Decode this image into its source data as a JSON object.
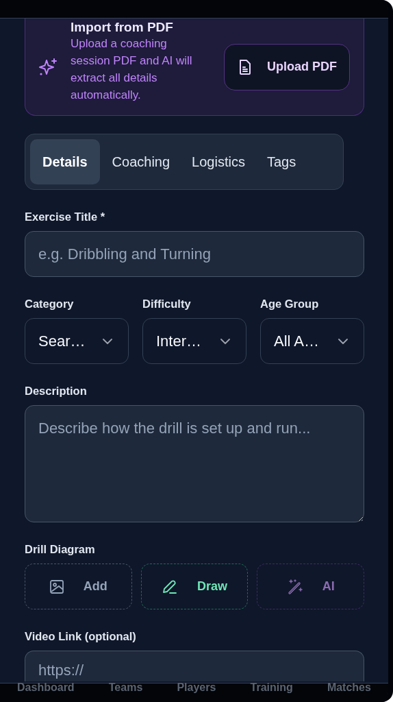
{
  "import_card": {
    "title": "Import from PDF",
    "description": "Upload a coaching session PDF and AI will extract all details automatically.",
    "button": "Upload PDF"
  },
  "tabs": [
    {
      "label": "Details",
      "selected": true
    },
    {
      "label": "Coaching",
      "selected": false
    },
    {
      "label": "Logistics",
      "selected": false
    },
    {
      "label": "Tags",
      "selected": false
    }
  ],
  "exercise_title": {
    "label": "Exercise Title *",
    "placeholder": "e.g. Dribbling and Turning"
  },
  "selects": [
    {
      "label": "Category",
      "value": "Sear…"
    },
    {
      "label": "Difficulty",
      "value": "Inter…"
    },
    {
      "label": "Age Group",
      "value": "All A…"
    }
  ],
  "description": {
    "label": "Description",
    "placeholder": "Describe how the drill is set up and run..."
  },
  "drill_diagram": {
    "label": "Drill Diagram",
    "buttons": [
      {
        "kind": "add",
        "label": "Add"
      },
      {
        "kind": "draw",
        "label": "Draw"
      },
      {
        "kind": "ai",
        "label": "AI"
      }
    ]
  },
  "video_link": {
    "label": "Video Link (optional)",
    "placeholder": "https://"
  },
  "bottom_nav": [
    "Dashboard",
    "Teams",
    "Players",
    "Training",
    "Matches"
  ]
}
